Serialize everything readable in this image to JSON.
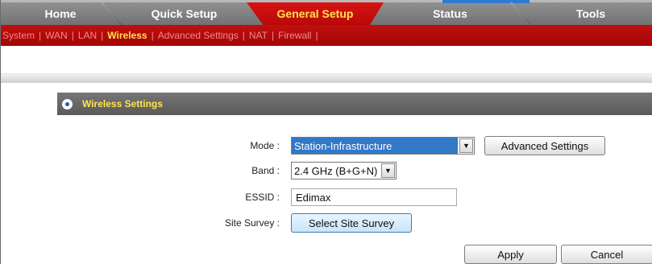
{
  "nav": {
    "tabs": [
      {
        "label": "Home"
      },
      {
        "label": "Quick Setup"
      },
      {
        "label": "General Setup"
      },
      {
        "label": "Status"
      },
      {
        "label": "Tools"
      }
    ],
    "active_tab": "General Setup"
  },
  "subnav": {
    "items": [
      {
        "label": "System"
      },
      {
        "label": "WAN"
      },
      {
        "label": "LAN"
      },
      {
        "label": "Wireless"
      },
      {
        "label": "Advanced Settings"
      },
      {
        "label": "NAT"
      },
      {
        "label": "Firewall"
      }
    ],
    "separator": "|",
    "active_item": "Wireless"
  },
  "section": {
    "title": "Wireless Settings"
  },
  "form": {
    "mode": {
      "label": "Mode :",
      "value": "Station-Infrastructure"
    },
    "advanced_button": "Advanced Settings",
    "band": {
      "label": "Band :",
      "value": "2.4 GHz (B+G+N)"
    },
    "essid": {
      "label": "ESSID :",
      "value": "Edimax"
    },
    "site_survey": {
      "label": "Site Survey :",
      "button": "Select Site Survey"
    }
  },
  "actions": {
    "apply": "Apply",
    "cancel": "Cancel"
  },
  "icons": {
    "dropdown_arrow": "▼"
  },
  "colors": {
    "accent_red": "#c10f0f",
    "active_yellow": "#ffe44d",
    "selection_blue": "#3178c6"
  }
}
